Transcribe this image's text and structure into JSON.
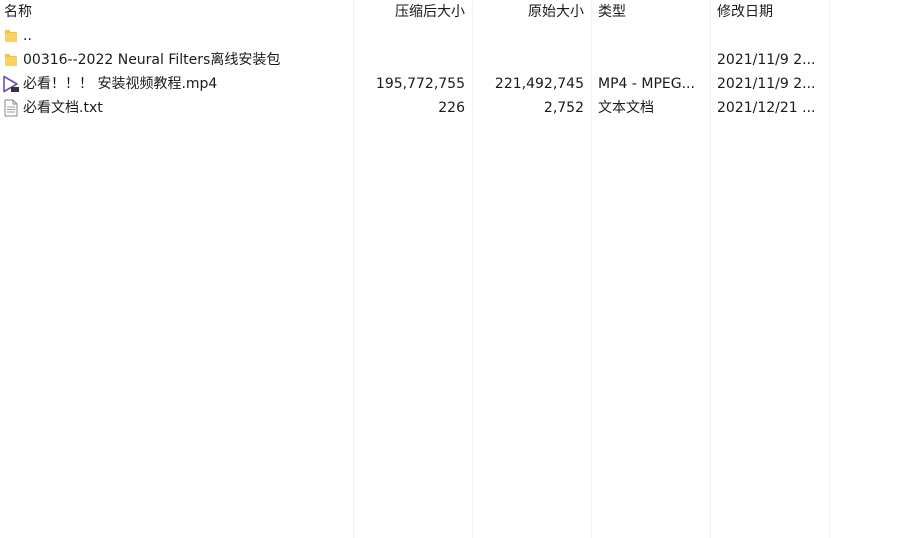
{
  "header": {
    "name": "名称",
    "compressed": "压缩后大小",
    "original": "原始大小",
    "type": "类型",
    "modified": "修改日期",
    "sort_arrow": "^"
  },
  "rows": [
    {
      "icon": "folder-icon",
      "name": "..",
      "compressed": "",
      "original": "",
      "type": "",
      "modified": ""
    },
    {
      "icon": "folder-icon",
      "name": "00316--2022 Neural Filters离线安装包",
      "compressed": "",
      "original": "",
      "type": "",
      "modified": "2021/11/9 2..."
    },
    {
      "icon": "video-file-icon",
      "name": "必看！！！ 安装视频教程.mp4",
      "compressed": "195,772,755",
      "original": "221,492,745",
      "type": "MP4 - MPEG...",
      "modified": "2021/11/9 2..."
    },
    {
      "icon": "text-file-icon",
      "name": "必看文档.txt",
      "compressed": "226",
      "original": "2,752",
      "type": "文本文档",
      "modified": "2021/12/21 ..."
    }
  ],
  "colors": {
    "folder": "#f5c242",
    "video_play": "#6b4fbb",
    "separator": "#f0f0f0"
  }
}
